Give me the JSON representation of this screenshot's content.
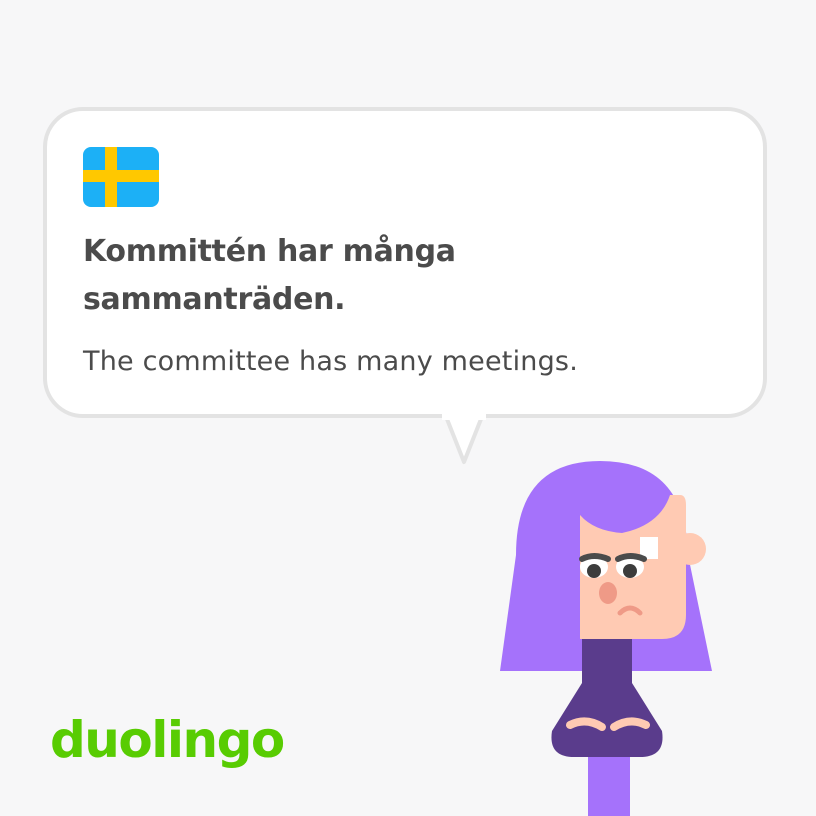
{
  "flag": {
    "icon": "sweden-flag-icon",
    "colors": {
      "blue": "#1cb0f6",
      "yellow": "#ffc800"
    }
  },
  "phrase": {
    "sentence": "Kommittén har många sammanträden.",
    "translation": "The committee has many meetings."
  },
  "brand": {
    "logo_text": "duolingo",
    "color": "#58cc02"
  },
  "character": {
    "icon": "lily-character-icon",
    "colors": {
      "hair": "#a572fb",
      "skin": "#ffcab3",
      "nose": "#ef9a87",
      "sweater": "#5a3c8c"
    }
  },
  "colors": {
    "background": "#f7f7f8",
    "bubble_border": "#e3e3e3",
    "text": "#4b4b4b"
  }
}
